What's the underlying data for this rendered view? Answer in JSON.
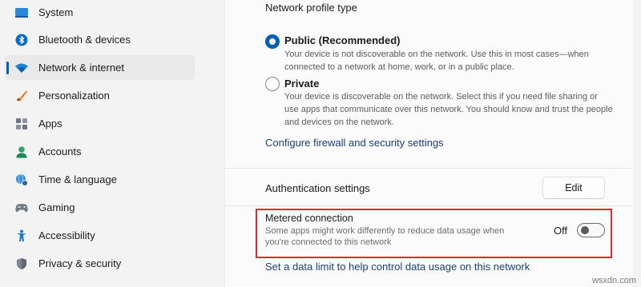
{
  "sidebar": {
    "items": [
      {
        "label": "System",
        "icon": "monitor-icon"
      },
      {
        "label": "Bluetooth & devices",
        "icon": "bluetooth-icon"
      },
      {
        "label": "Network & internet",
        "icon": "wifi-icon",
        "selected": true
      },
      {
        "label": "Personalization",
        "icon": "brush-icon"
      },
      {
        "label": "Apps",
        "icon": "apps-icon"
      },
      {
        "label": "Accounts",
        "icon": "person-icon"
      },
      {
        "label": "Time & language",
        "icon": "globe-clock-icon"
      },
      {
        "label": "Gaming",
        "icon": "gamepad-icon"
      },
      {
        "label": "Accessibility",
        "icon": "accessibility-icon"
      },
      {
        "label": "Privacy & security",
        "icon": "shield-icon"
      }
    ]
  },
  "main": {
    "section_title": "Network profile type",
    "profiles": [
      {
        "title": "Public (Recommended)",
        "description": "Your device is not discoverable on the network. Use this in most cases—when connected to a network at home, work, or in a public place.",
        "checked": true
      },
      {
        "title": "Private",
        "description": "Your device is discoverable on the network. Select this if you need file sharing or use apps that communicate over this network. You should know and trust the people and devices on the network.",
        "checked": false
      }
    ],
    "firewall_link": "Configure firewall and security settings",
    "auth": {
      "label": "Authentication settings",
      "button": "Edit"
    },
    "metered": {
      "title": "Metered connection",
      "description": "Some apps might work differently to reduce data usage when you're connected to this network",
      "toggle_label": "Off",
      "toggle_on": false
    },
    "data_limit_link": "Set a data limit to help control data usage on this network"
  },
  "watermark": "wsxdn.com",
  "colors": {
    "accent": "#005fb8",
    "highlight_border": "#e5262a",
    "link": "#1a3f7a"
  }
}
